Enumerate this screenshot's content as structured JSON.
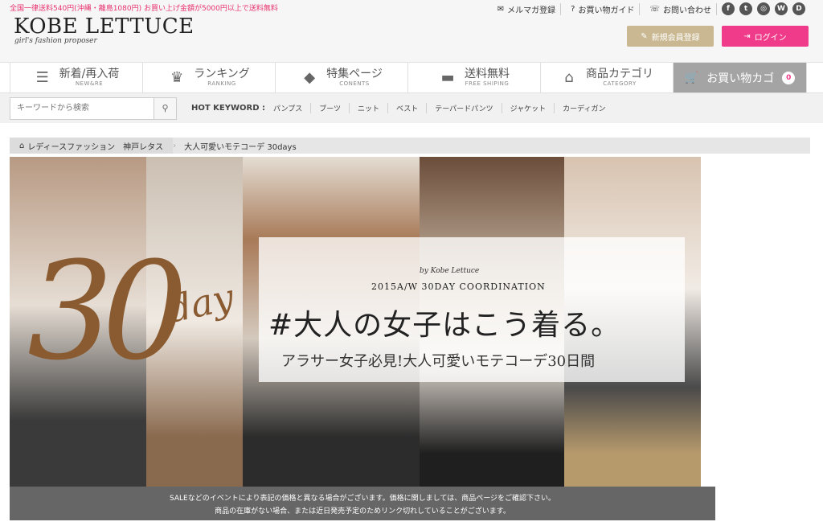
{
  "header": {
    "promo": "全国一律送料540円(沖縄・離島1080円) お買い上げ金額が5000円以上で送料無料",
    "logo": "KOBE LETTUCE",
    "tagline": "girl's fashion proposer",
    "utility_links": [
      {
        "label": "メルマガ登録",
        "icon": "mail-icon"
      },
      {
        "label": "お買い物ガイド",
        "icon": "question-icon"
      },
      {
        "label": "お問い合わせ",
        "icon": "phone-icon"
      }
    ],
    "social": [
      {
        "name": "facebook-icon",
        "glyph": "f"
      },
      {
        "name": "twitter-icon",
        "glyph": "t"
      },
      {
        "name": "instagram-icon",
        "glyph": "◎"
      },
      {
        "name": "wear-icon",
        "glyph": "W"
      },
      {
        "name": "line-icon",
        "glyph": "D"
      }
    ],
    "register_label": "新規会員登録",
    "login_label": "ログイン"
  },
  "nav": {
    "items": [
      {
        "label": "新着/再入荷",
        "sub": "NEW&RE",
        "icon": "list-icon",
        "glyph": "☰"
      },
      {
        "label": "ランキング",
        "sub": "RANKING",
        "icon": "crown-icon",
        "glyph": "♛"
      },
      {
        "label": "特集ページ",
        "sub": "CONENTS",
        "icon": "tag-icon",
        "glyph": "◆"
      },
      {
        "label": "送料無料",
        "sub": "FREE SHIPING",
        "icon": "truck-icon",
        "glyph": "▬"
      },
      {
        "label": "商品カテゴリ",
        "sub": "CATEGORY",
        "icon": "category-search-icon",
        "glyph": "⌂"
      }
    ],
    "cart_label": "お買い物カゴ",
    "cart_count": "0"
  },
  "search": {
    "placeholder": "キーワードから検索",
    "hot_label": "HOT KEYWORD :",
    "keywords": [
      "パンプス",
      "ブーツ",
      "ニット",
      "ベスト",
      "テーパードパンツ",
      "ジャケット",
      "カーディガン"
    ]
  },
  "breadcrumb": {
    "items": [
      "レディースファッション　神戸レタス",
      "大人可愛いモテコーデ 30days"
    ]
  },
  "banner": {
    "by_line": "by Kobe Lettuce",
    "season": "2015A/W 30DAY COORDINATION",
    "headline": "#大人の女子はこう着る。",
    "subhead": "アラサー女子必見!大人可愛いモテコーデ30日間",
    "big_number": "30",
    "day_word": "day"
  },
  "notice": {
    "line1": "SALEなどのイベントにより表記の価格と異なる場合がございます。価格に関しましては、商品ページをご確認下さい。",
    "line2": "商品の在庫がない場合、または近日発売予定のためリンク切れしていることがございます。"
  }
}
